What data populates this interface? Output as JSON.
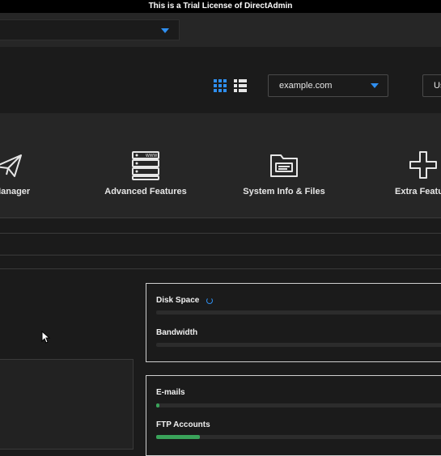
{
  "trial_notice": "This is a Trial License of DirectAdmin",
  "header": {
    "domain_select": {
      "value": "example.com"
    },
    "user_button_label": "Us"
  },
  "categories": [
    {
      "label": "il Manager",
      "icon": "paper-plane-icon"
    },
    {
      "label": "Advanced Features",
      "icon": "server-www-icon"
    },
    {
      "label": "System Info & Files",
      "icon": "folder-icon"
    },
    {
      "label": "Extra Featu",
      "icon": "plus-icon"
    }
  ],
  "stats": {
    "disk_space": {
      "label": "Disk Space",
      "fraction": 0.0
    },
    "bandwidth": {
      "label": "Bandwidth",
      "fraction": 0.0
    },
    "emails": {
      "label": "E-mails",
      "fraction": 0.01
    },
    "ftp_accounts": {
      "label": "FTP Accounts",
      "fraction": 0.15
    }
  },
  "colors": {
    "accent": "#2f8ff0",
    "progress": "#3aa35a"
  }
}
